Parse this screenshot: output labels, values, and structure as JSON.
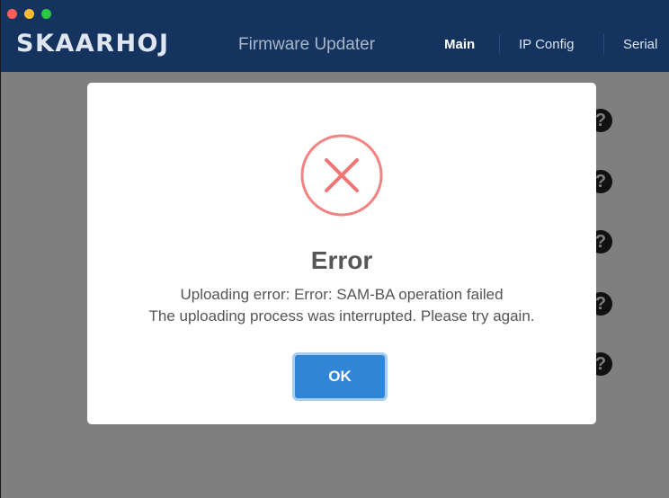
{
  "window": {
    "logo": "SKAARHOJ",
    "app_title": "Firmware Updater"
  },
  "nav": {
    "main": "Main",
    "ip_config": "IP Config",
    "serial": "Serial"
  },
  "background": {
    "help_glyph": "?"
  },
  "dialog": {
    "icon": "error-x-icon",
    "title": "Error",
    "line1": "Uploading error: Error: SAM-BA operation failed",
    "line2": "The uploading process was interrupted. Please try again.",
    "ok_label": "OK"
  },
  "colors": {
    "titlebar": "#15335f",
    "error_icon": "#f27474",
    "ok_button": "#3085d6"
  }
}
